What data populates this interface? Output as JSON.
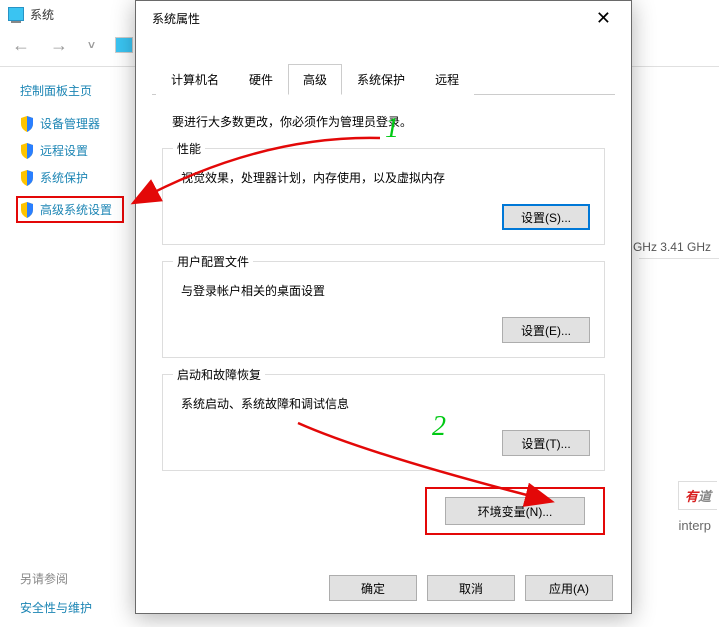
{
  "bg": {
    "title": "系统",
    "sidebar_title": "控制面板主页",
    "sidebar_items": [
      {
        "label": "设备管理器"
      },
      {
        "label": "远程设置"
      },
      {
        "label": "系统保护"
      },
      {
        "label": "高级系统设置"
      }
    ],
    "bottom_title": "另请参阅",
    "bottom_link": "安全性与维护",
    "right_ghz": "GHz   3.41 GHz",
    "right_cut": "interp",
    "brand1": "有",
    "brand2": "道"
  },
  "dialog": {
    "title": "系统属性",
    "tabs": [
      "计算机名",
      "硬件",
      "高级",
      "系统保护",
      "远程"
    ],
    "active_tab": 2,
    "admin_note": "要进行大多数更改，你必须作为管理员登录。",
    "groups": [
      {
        "title": "性能",
        "desc": "视觉效果，处理器计划，内存使用，以及虚拟内存",
        "btn": "设置(S)..."
      },
      {
        "title": "用户配置文件",
        "desc": "与登录帐户相关的桌面设置",
        "btn": "设置(E)..."
      },
      {
        "title": "启动和故障恢复",
        "desc": "系统启动、系统故障和调试信息",
        "btn": "设置(T)..."
      }
    ],
    "env_btn": "环境变量(N)...",
    "footer": {
      "ok": "确定",
      "cancel": "取消",
      "apply": "应用(A)"
    }
  },
  "annotations": {
    "num1": "1",
    "num2": "2"
  }
}
